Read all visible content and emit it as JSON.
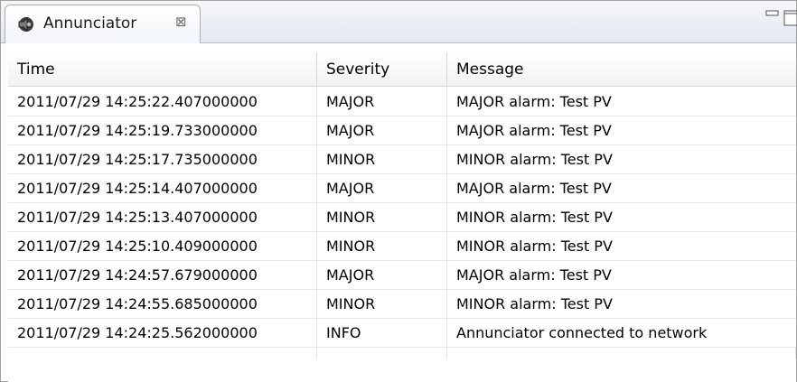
{
  "view": {
    "tab_label": "Annunciator",
    "tab_close_glyph": "⊠"
  },
  "table": {
    "columns": [
      "Time",
      "Severity",
      "Message"
    ],
    "rows": [
      {
        "time": "2011/07/29 14:25:22.407000000",
        "severity": "MAJOR",
        "message": "MAJOR alarm: Test PV"
      },
      {
        "time": "2011/07/29 14:25:19.733000000",
        "severity": "MAJOR",
        "message": "MAJOR alarm: Test PV"
      },
      {
        "time": "2011/07/29 14:25:17.735000000",
        "severity": "MINOR",
        "message": "MINOR alarm: Test PV"
      },
      {
        "time": "2011/07/29 14:25:14.407000000",
        "severity": "MAJOR",
        "message": "MAJOR alarm: Test PV"
      },
      {
        "time": "2011/07/29 14:25:13.407000000",
        "severity": "MINOR",
        "message": "MINOR alarm: Test PV"
      },
      {
        "time": "2011/07/29 14:25:10.409000000",
        "severity": "MINOR",
        "message": "MINOR alarm: Test PV"
      },
      {
        "time": "2011/07/29 14:24:57.679000000",
        "severity": "MAJOR",
        "message": "MAJOR alarm: Test PV"
      },
      {
        "time": "2011/07/29 14:24:55.685000000",
        "severity": "MINOR",
        "message": "MINOR alarm: Test PV"
      },
      {
        "time": "2011/07/29 14:24:25.562000000",
        "severity": "INFO",
        "message": "Annunciator connected to network"
      }
    ]
  },
  "icons": {
    "tab_icon": "speaker-icon",
    "minimize": "minimize-icon",
    "maximize": "maximize-icon"
  }
}
